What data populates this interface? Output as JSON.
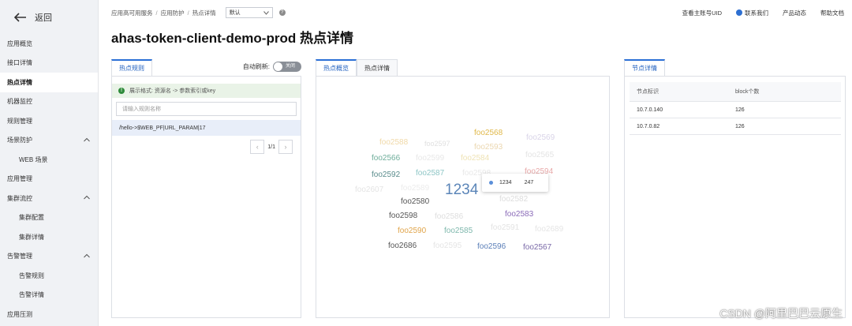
{
  "sidebar": {
    "back_label": "返回",
    "items": [
      {
        "label": "应用概览",
        "sub": false,
        "active": false,
        "caret": false
      },
      {
        "label": "接口详情",
        "sub": false,
        "active": false,
        "caret": false
      },
      {
        "label": "热点详情",
        "sub": false,
        "active": true,
        "caret": false
      },
      {
        "label": "机器监控",
        "sub": false,
        "active": false,
        "caret": false
      },
      {
        "label": "规则管理",
        "sub": false,
        "active": false,
        "caret": false
      },
      {
        "label": "场景防护",
        "sub": false,
        "active": false,
        "caret": true
      },
      {
        "label": "WEB 场景",
        "sub": true,
        "active": false,
        "caret": false
      },
      {
        "label": "应用管理",
        "sub": false,
        "active": false,
        "caret": false
      },
      {
        "label": "集群流控",
        "sub": false,
        "active": false,
        "caret": true
      },
      {
        "label": "集群配置",
        "sub": true,
        "active": false,
        "caret": false
      },
      {
        "label": "集群详情",
        "sub": true,
        "active": false,
        "caret": false
      },
      {
        "label": "告警管理",
        "sub": false,
        "active": false,
        "caret": true
      },
      {
        "label": "告警规则",
        "sub": true,
        "active": false,
        "caret": false
      },
      {
        "label": "告警详情",
        "sub": true,
        "active": false,
        "caret": false
      },
      {
        "label": "应用压测",
        "sub": false,
        "active": false,
        "caret": false
      }
    ]
  },
  "breadcrumb": {
    "items": [
      "应用高可用服务",
      "应用防护",
      "热点详情"
    ],
    "select_value": "默认"
  },
  "top_links": {
    "account": "查看主账号UID",
    "contact": "联系我们",
    "news": "产品动态",
    "docs": "帮助文档"
  },
  "page_title": "ahas-token-client-demo-prod 热点详情",
  "left_panel": {
    "tab": "热点规则",
    "auto_refresh_label": "自动刷新:",
    "toggle_text": "关闭",
    "info_text": "展示格式: 资源名 -> 参数索引或key",
    "search_placeholder": "请输入规则名称",
    "rule_row": "/hello->$WEB_PF|URL_PARAM|17",
    "page_info": "1/1"
  },
  "middle_panel": {
    "tabs": [
      "热点概览",
      "热点详情"
    ],
    "tooltip": {
      "name": "1234",
      "value": "247"
    },
    "words": [
      {
        "text": "foo2588",
        "color": "#f0d9a8",
        "size": 10
      },
      {
        "text": "foo2597",
        "color": "#e0e0e0",
        "size": 9
      },
      {
        "text": "foo2568",
        "color": "#e0b84a",
        "size": 10
      },
      {
        "text": "foo2569",
        "color": "#d9d4e8",
        "size": 10
      },
      {
        "text": "foo2593",
        "color": "#ebd7b0",
        "size": 10
      },
      {
        "text": "foo2566",
        "color": "#6fae9b",
        "size": 10
      },
      {
        "text": "foo2599",
        "color": "#e8e8e8",
        "size": 10
      },
      {
        "text": "foo2584",
        "color": "#efe3b5",
        "size": 10
      },
      {
        "text": "foo2565",
        "color": "#e4e4e4",
        "size": 10
      },
      {
        "text": "foo2592",
        "color": "#5a8c8c",
        "size": 10
      },
      {
        "text": "foo2587",
        "color": "#8ec6c6",
        "size": 10
      },
      {
        "text": "foo2598",
        "color": "#e8e8e8",
        "size": 10
      },
      {
        "text": "foo2594",
        "color": "#e8a8a8",
        "size": 10
      },
      {
        "text": "foo2607",
        "color": "#e4e4e4",
        "size": 10
      },
      {
        "text": "foo2589",
        "color": "#ececec",
        "size": 10
      },
      {
        "text": "1234",
        "color": "#5b85b8",
        "size": 19
      },
      {
        "text": "foo2580",
        "color": "#555555",
        "size": 10
      },
      {
        "text": "foo2582",
        "color": "#dcdcdc",
        "size": 10
      },
      {
        "text": "foo2598",
        "color": "#555555",
        "size": 10
      },
      {
        "text": "foo2586",
        "color": "#dedede",
        "size": 10
      },
      {
        "text": "foo2583",
        "color": "#8a6ab8",
        "size": 10
      },
      {
        "text": "foo2590",
        "color": "#e0a44a",
        "size": 10
      },
      {
        "text": "foo2585",
        "color": "#7fb8ad",
        "size": 10
      },
      {
        "text": "foo2591",
        "color": "#e3e3e3",
        "size": 10
      },
      {
        "text": "foo2689",
        "color": "#e5e5e5",
        "size": 10
      },
      {
        "text": "foo2686",
        "color": "#555555",
        "size": 10
      },
      {
        "text": "foo2595",
        "color": "#e5e5e5",
        "size": 10
      },
      {
        "text": "foo2596",
        "color": "#5b7fb8",
        "size": 10
      },
      {
        "text": "foo2567",
        "color": "#7a6aa8",
        "size": 10
      }
    ]
  },
  "right_panel": {
    "tab": "节点详情",
    "columns": [
      "节点标识",
      "block个数"
    ],
    "rows": [
      [
        "10.7.0.140",
        "126"
      ],
      [
        "10.7.0.82",
        "126"
      ]
    ]
  },
  "watermark": "CSDN @阿里巴巴云原生"
}
